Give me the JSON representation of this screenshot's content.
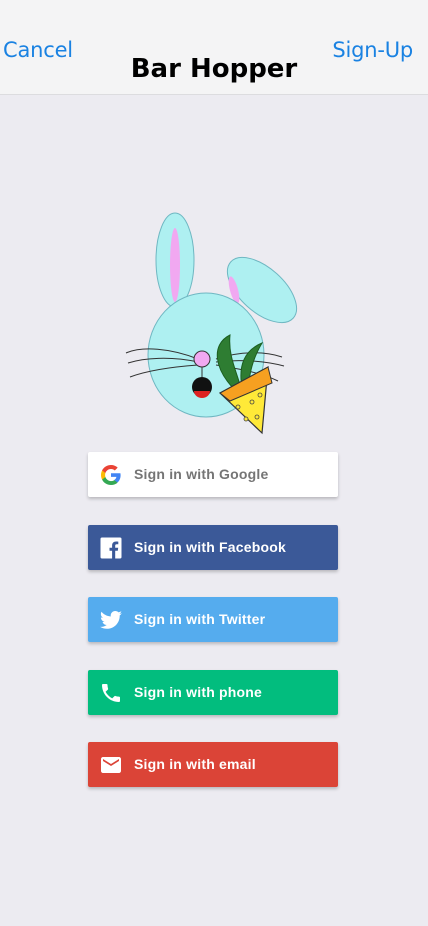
{
  "nav": {
    "cancel_label": "Cancel",
    "title": "Bar Hopper",
    "signup_label": "Sign-Up"
  },
  "colors": {
    "accent": "#1a82e2",
    "google": "#ffffff",
    "facebook": "#3b5998",
    "twitter": "#55acee",
    "phone": "#02bd7e",
    "email": "#db4437"
  },
  "buttons": [
    {
      "id": "google",
      "label": "Sign in with Google",
      "icon": "google-icon"
    },
    {
      "id": "facebook",
      "label": "Sign in with Facebook",
      "icon": "facebook-icon"
    },
    {
      "id": "twitter",
      "label": "Sign in with Twitter",
      "icon": "twitter-icon"
    },
    {
      "id": "phone",
      "label": "Sign in with phone",
      "icon": "phone-icon"
    },
    {
      "id": "email",
      "label": "Sign in with email",
      "icon": "email-icon"
    }
  ]
}
